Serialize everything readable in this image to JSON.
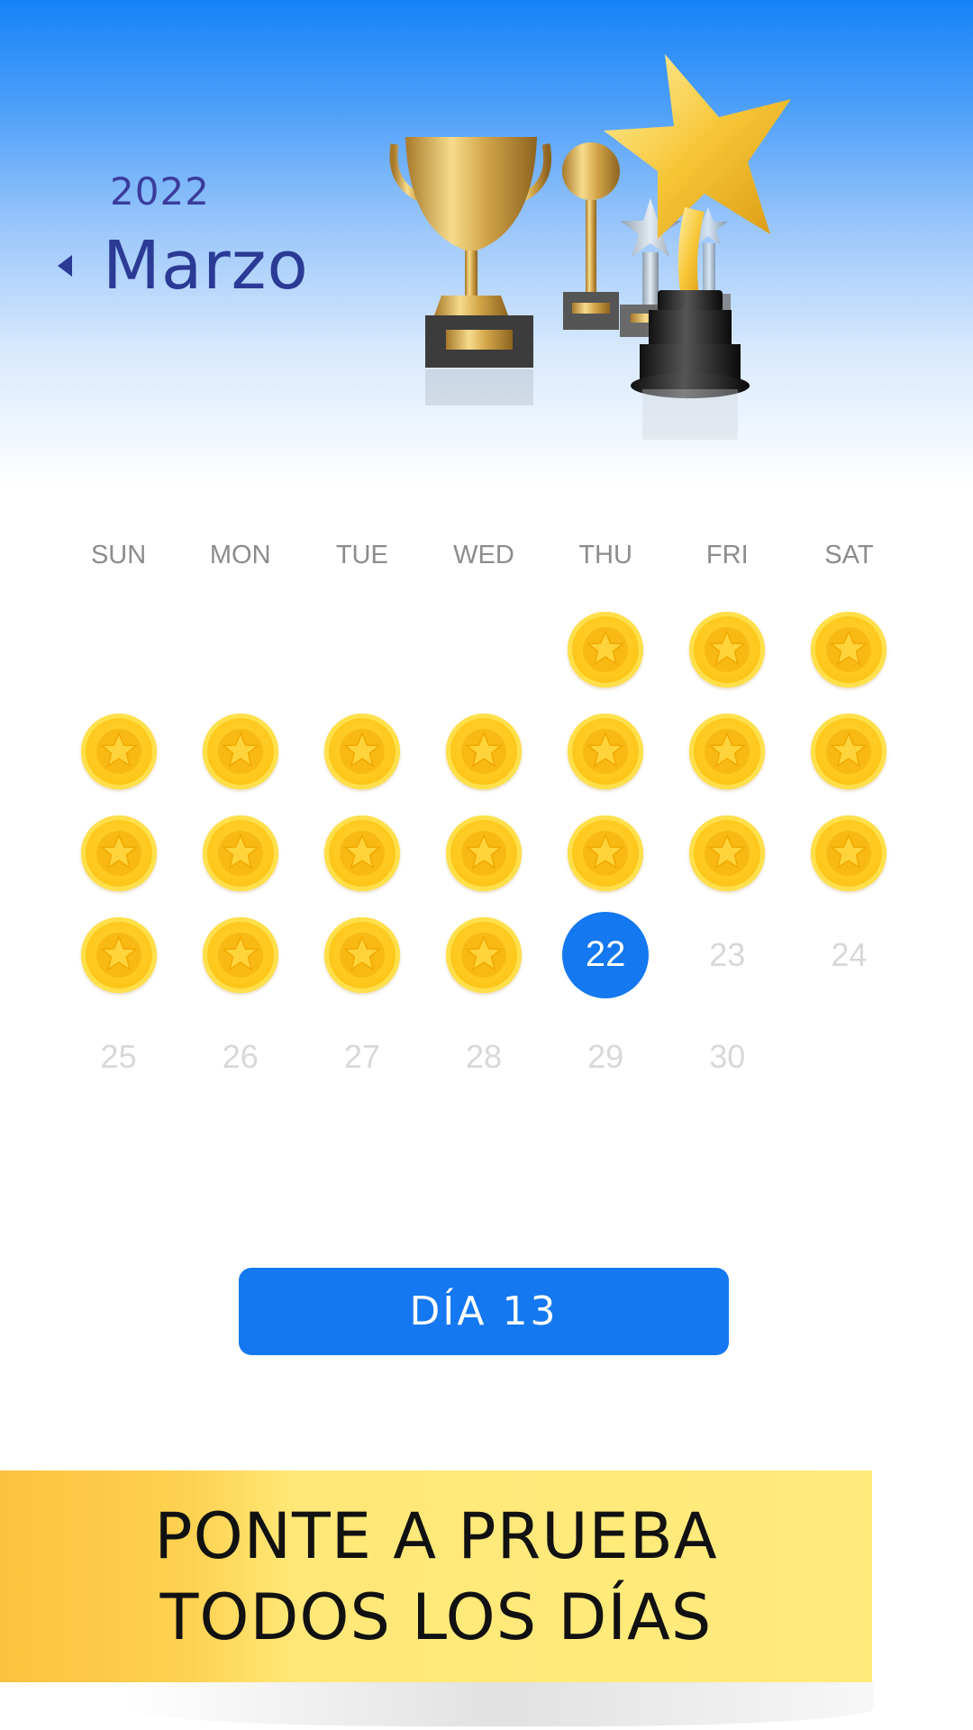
{
  "header": {
    "year": "2022",
    "month": "Marzo"
  },
  "weekdays": [
    "SUN",
    "MON",
    "TUE",
    "WED",
    "THU",
    "FRI",
    "SAT"
  ],
  "calendar": {
    "weeks": [
      [
        null,
        null,
        null,
        null,
        {
          "state": "completed"
        },
        {
          "state": "completed"
        },
        {
          "state": "completed"
        }
      ],
      [
        {
          "state": "completed"
        },
        {
          "state": "completed"
        },
        {
          "state": "completed"
        },
        {
          "state": "completed"
        },
        {
          "state": "completed"
        },
        {
          "state": "completed"
        },
        {
          "state": "completed"
        }
      ],
      [
        {
          "state": "completed"
        },
        {
          "state": "completed"
        },
        {
          "state": "completed"
        },
        {
          "state": "completed"
        },
        {
          "state": "completed"
        },
        {
          "state": "completed"
        },
        {
          "state": "completed"
        }
      ],
      [
        {
          "state": "completed"
        },
        {
          "state": "completed"
        },
        {
          "state": "completed"
        },
        {
          "state": "completed"
        },
        {
          "day": "22",
          "state": "today"
        },
        {
          "day": "23",
          "state": "future"
        },
        {
          "day": "24",
          "state": "future"
        }
      ],
      [
        {
          "day": "25",
          "state": "future"
        },
        {
          "day": "26",
          "state": "future"
        },
        {
          "day": "27",
          "state": "future"
        },
        {
          "day": "28",
          "state": "future"
        },
        {
          "day": "29",
          "state": "future"
        },
        {
          "day": "30",
          "state": "future"
        },
        null
      ]
    ]
  },
  "day_button": {
    "label": "DÍA 13"
  },
  "banner": {
    "line1": "PONTE A PRUEBA",
    "line2": "TODOS LOS DÍAS"
  },
  "colors": {
    "accent": "#1478f0",
    "month_text": "#2b3a95",
    "coin": "#ffc81e",
    "banner": "#ffe878"
  },
  "icons": {
    "completed_day": "star-coin-icon",
    "prev": "chevron-left-icon",
    "illustration": "trophies-illustration"
  }
}
